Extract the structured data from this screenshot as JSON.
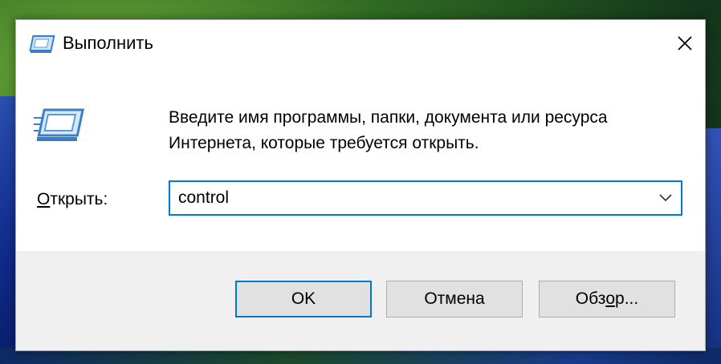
{
  "window": {
    "title": "Выполнить",
    "close_icon": "close-icon"
  },
  "dialog": {
    "prompt": "Введите имя программы, папки, документа или ресурса Интернета, которые требуется открыть.",
    "open_label_prefix": "О",
    "open_label_rest": "ткрыть:",
    "input_value": "control",
    "dropdown_icon": "chevron-down-icon",
    "app_icon": "run-dialog-icon"
  },
  "buttons": {
    "ok_label": "OK",
    "cancel_label": "Отмена",
    "browse_prefix": "Обз",
    "browse_accel": "о",
    "browse_suffix": "р..."
  },
  "colors": {
    "accent": "#0078d7",
    "dialog_bg": "#f0f0f0",
    "content_bg": "#ffffff"
  }
}
